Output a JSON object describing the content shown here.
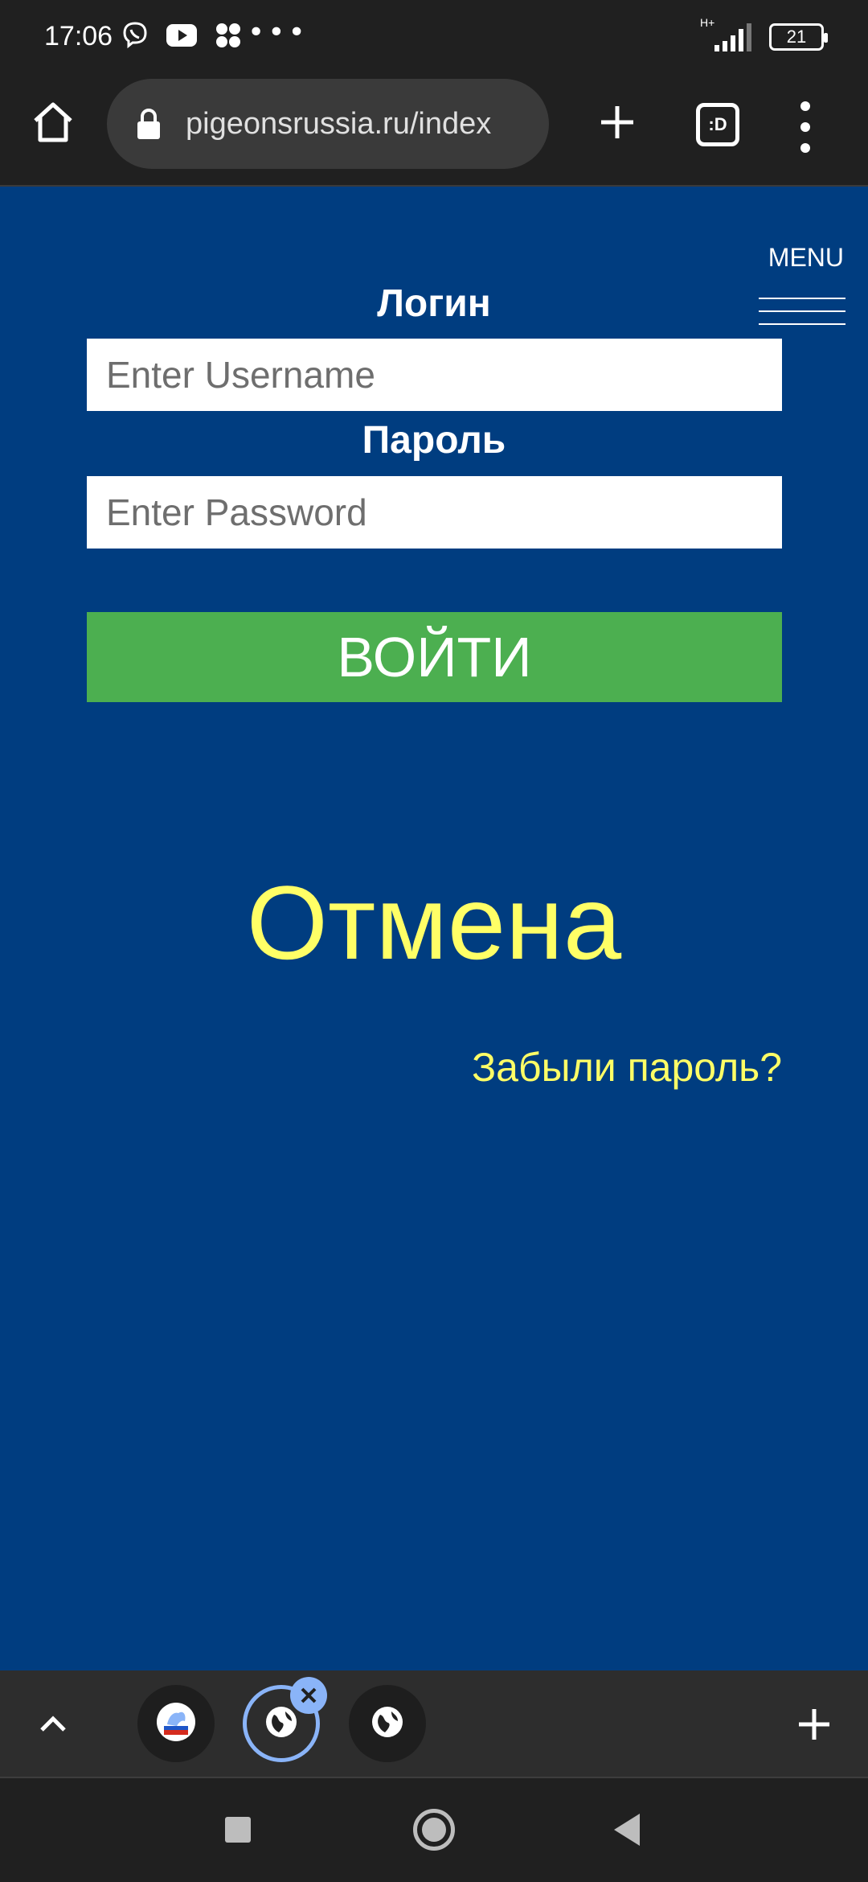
{
  "status_bar": {
    "time": "17:06",
    "icons": [
      "viber-icon",
      "youtube-icon",
      "app-icon"
    ],
    "network": "H+",
    "battery": "21"
  },
  "browser": {
    "url": "pigeonsrussia.ru/index",
    "tabs_icon_label": ":D"
  },
  "page": {
    "menu_label": "MENU",
    "login_label": "Логин",
    "username_placeholder": "Enter Username",
    "password_label": "Пароль",
    "password_placeholder": "Enter Password",
    "login_button": "ВОЙТИ",
    "cancel": "Отмена",
    "forgot_password": "Забыли пароль?"
  },
  "colors": {
    "page_bg": "#003d80",
    "button_green": "#4caf50",
    "accent_yellow": "#ffff66",
    "tab_active": "#8ab4f8"
  },
  "tab_strip": {
    "tabs": [
      "site-favicon",
      "globe-icon",
      "globe-icon"
    ]
  }
}
